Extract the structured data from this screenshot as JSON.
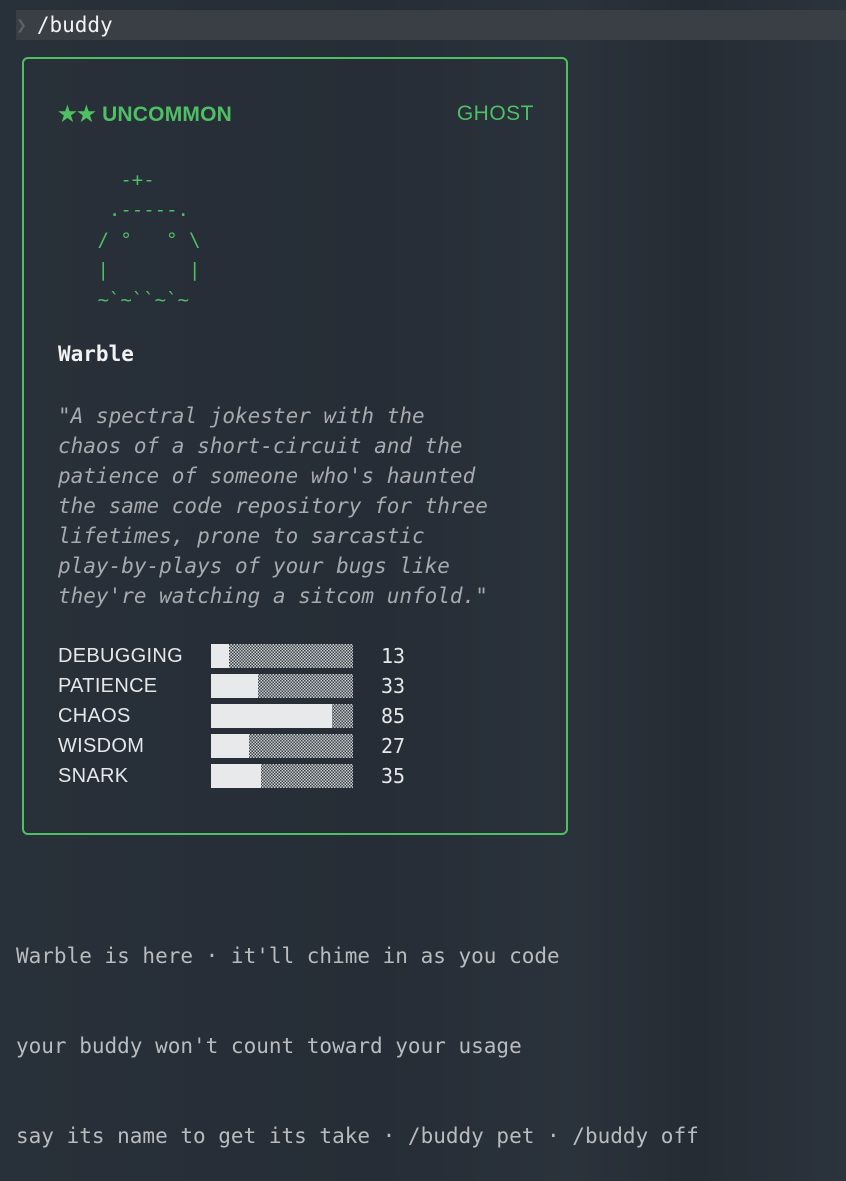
{
  "prompt": {
    "chevron": "❯",
    "command": "/buddy"
  },
  "card": {
    "stars": "★★",
    "rarity": "UNCOMMON",
    "species": "GHOST",
    "art": "   -+-\n  .-----.\n / °   ° \\\n |       |\n ~`~``~`~",
    "name": "Warble",
    "description": "\"A spectral jokester with the\nchaos of a short-circuit and the\npatience of someone who's haunted\nthe same code repository for three\n lifetimes, prone to sarcastic\nplay-by-plays of your bugs like\nthey're watching a sitcom unfold.\"",
    "stats": [
      {
        "label": "DEBUGGING",
        "value": 13
      },
      {
        "label": "PATIENCE",
        "value": 33
      },
      {
        "label": "CHAOS",
        "value": 85
      },
      {
        "label": "WISDOM",
        "value": 27
      },
      {
        "label": "SNARK",
        "value": 35
      }
    ]
  },
  "footer": {
    "line1": "Warble is here · it'll chime in as you code",
    "line2": "your buddy won't count toward your usage",
    "line3": "say its name to get its take · /buddy pet · /buddy off"
  },
  "colors": {
    "accent": "#4fbf63",
    "background": "#283039",
    "command_bar": "#3a3f45"
  }
}
